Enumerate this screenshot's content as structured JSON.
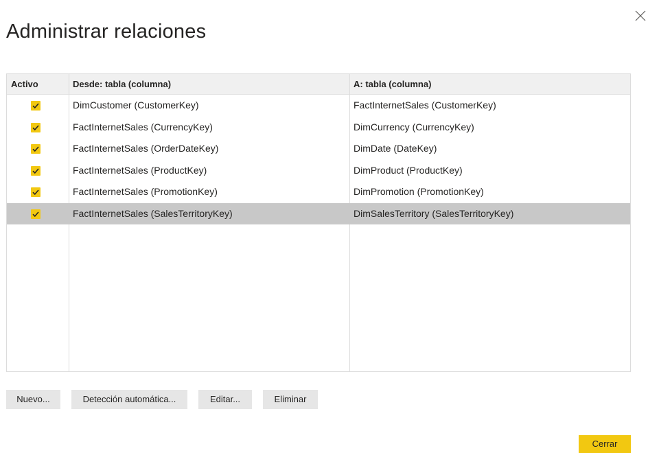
{
  "dialog": {
    "title": "Administrar relaciones",
    "close_icon": "close-icon"
  },
  "table": {
    "headers": {
      "active": "Activo",
      "from": "Desde: tabla (columna)",
      "to": "A: tabla (columna)"
    },
    "rows": [
      {
        "active": true,
        "from": "DimCustomer (CustomerKey)",
        "to": "FactInternetSales (CustomerKey)",
        "selected": false
      },
      {
        "active": true,
        "from": "FactInternetSales (CurrencyKey)",
        "to": "DimCurrency (CurrencyKey)",
        "selected": false
      },
      {
        "active": true,
        "from": "FactInternetSales (OrderDateKey)",
        "to": "DimDate (DateKey)",
        "selected": false
      },
      {
        "active": true,
        "from": "FactInternetSales (ProductKey)",
        "to": "DimProduct (ProductKey)",
        "selected": false
      },
      {
        "active": true,
        "from": "FactInternetSales (PromotionKey)",
        "to": "DimPromotion (PromotionKey)",
        "selected": false
      },
      {
        "active": true,
        "from": "FactInternetSales (SalesTerritoryKey)",
        "to": "DimSalesTerritory (SalesTerritoryKey)",
        "selected": true
      }
    ]
  },
  "buttons": {
    "new": "Nuevo...",
    "autodetect": "Detección automática...",
    "edit": "Editar...",
    "delete": "Eliminar",
    "close": "Cerrar"
  },
  "colors": {
    "accent": "#F2C811",
    "selected_row": "#C8C8C8",
    "header_bg": "#F0F0F0",
    "button_bg": "#E6E6E6"
  }
}
